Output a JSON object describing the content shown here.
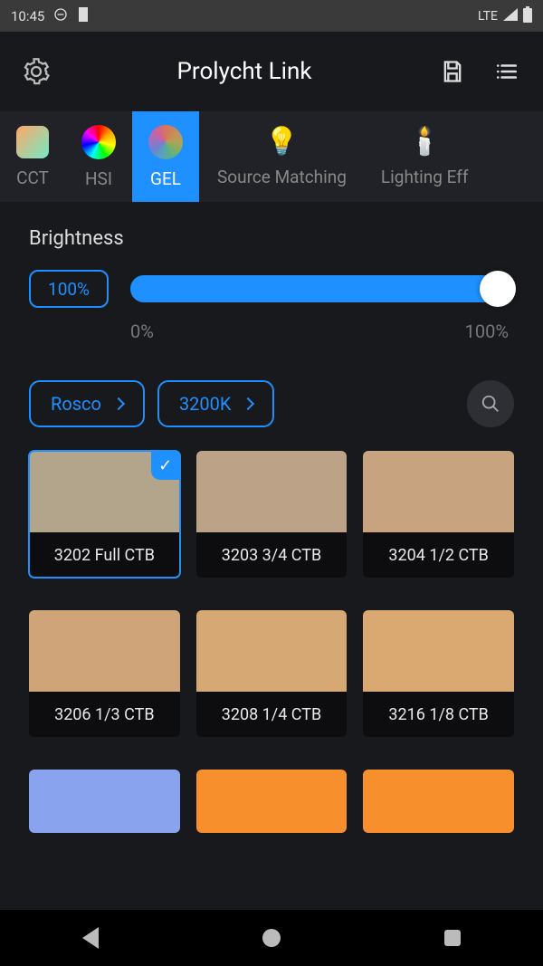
{
  "status": {
    "time": "10:45",
    "network": "LTE"
  },
  "header": {
    "title": "Prolycht Link"
  },
  "tabs": [
    "CCT",
    "HSI",
    "GEL",
    "Source Matching",
    "Lighting Eff"
  ],
  "active_tab": 2,
  "brightness": {
    "label": "Brightness",
    "value": "100%",
    "min_label": "0%",
    "max_label": "100%"
  },
  "filters": {
    "brand": "Rosco",
    "cct": "3200K"
  },
  "gels": [
    {
      "name": "3202 Full CTB",
      "color": "#b3a48c",
      "selected": true
    },
    {
      "name": "3203 3/4 CTB",
      "color": "#bca388"
    },
    {
      "name": "3204 1/2 CTB",
      "color": "#c7a47f"
    },
    {
      "name": "3206 1/3 CTB",
      "color": "#cfa478"
    },
    {
      "name": "3208 1/4 CTB",
      "color": "#d6a873"
    },
    {
      "name": "3216 1/8 CTB",
      "color": "#d9a971"
    },
    {
      "name": "",
      "color": "#8aa3ef"
    },
    {
      "name": "",
      "color": "#f78f2d"
    },
    {
      "name": "",
      "color": "#f78f2d"
    }
  ]
}
